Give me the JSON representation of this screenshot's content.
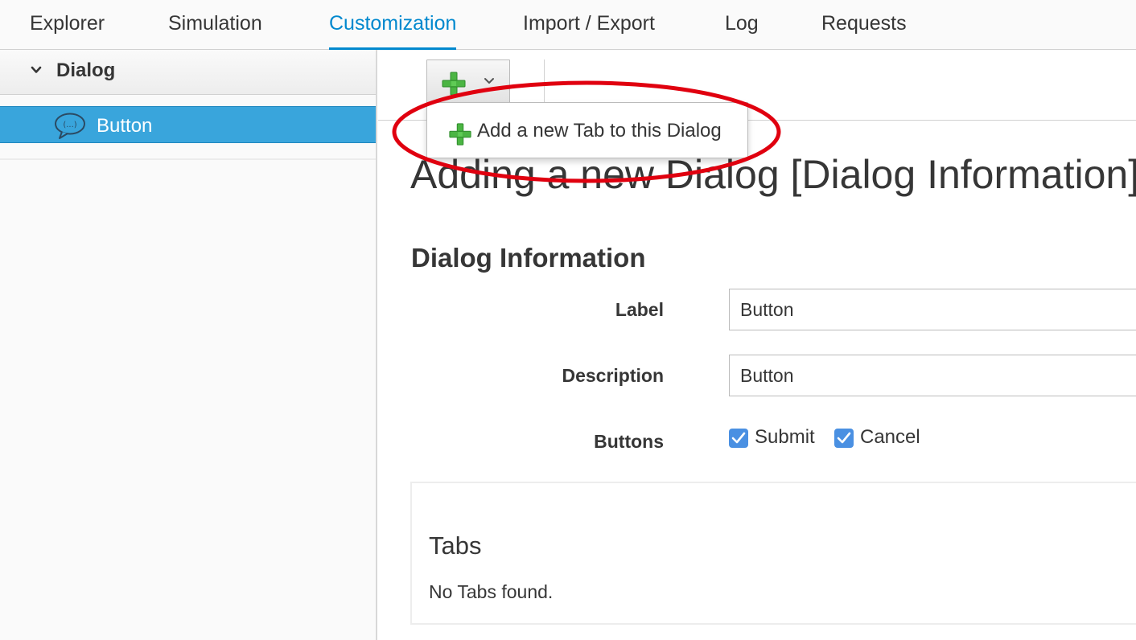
{
  "top_nav": {
    "tabs": [
      {
        "label": "Explorer",
        "active": false
      },
      {
        "label": "Simulation",
        "active": false
      },
      {
        "label": "Customization",
        "active": true
      },
      {
        "label": "Import / Export",
        "active": false
      },
      {
        "label": "Log",
        "active": false
      },
      {
        "label": "Requests",
        "active": false
      }
    ],
    "active_color": "#0088ce"
  },
  "sidebar": {
    "accordion_title": "Dialog",
    "accordion_icon": "chevron-down-icon",
    "selected_item": {
      "label": "Button",
      "icon": "speech-bubble-icon"
    },
    "selected_color": "#39a5dc"
  },
  "toolbar": {
    "add_button_icon": "plus-icon",
    "dropdown_icon": "chevron-down-icon",
    "menu_items": [
      {
        "label": "Add a new Tab to this Dialog",
        "icon": "plus-icon"
      }
    ]
  },
  "main": {
    "title": "Adding a new Dialog [Dialog Information]",
    "section_title": "Dialog Information",
    "fields": {
      "label": {
        "label": "Label",
        "value": "Button"
      },
      "description": {
        "label": "Description",
        "value": "Button"
      },
      "buttons": {
        "label": "Buttons",
        "options": [
          {
            "label": "Submit",
            "checked": true
          },
          {
            "label": "Cancel",
            "checked": true
          }
        ]
      }
    },
    "tabs_panel": {
      "title": "Tabs",
      "empty_text": "No Tabs found."
    }
  },
  "annotation": {
    "color": "#e0000f"
  }
}
